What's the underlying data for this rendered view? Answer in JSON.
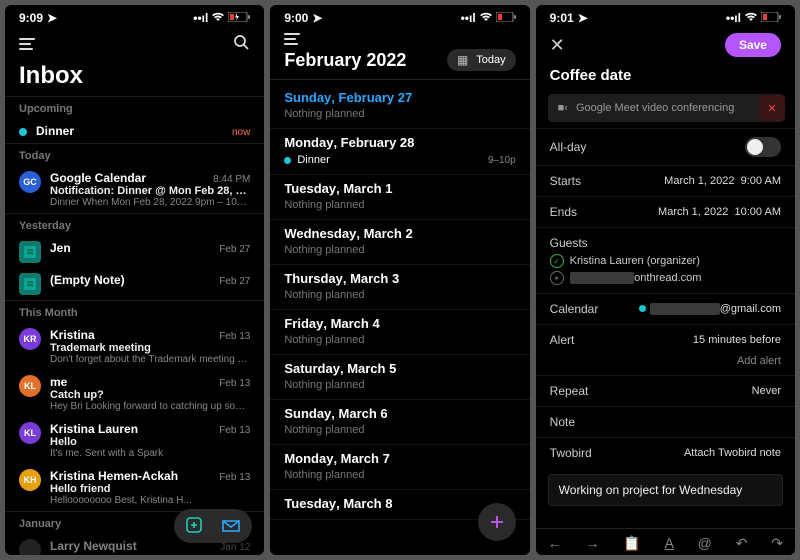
{
  "screen1": {
    "status_time": "9:09",
    "title": "Inbox",
    "sections": {
      "upcoming": "Upcoming",
      "today": "Today",
      "yesterday": "Yesterday",
      "this_month": "This Month",
      "january": "January"
    },
    "upcoming_item": {
      "label": "Dinner",
      "time": "now"
    },
    "today_item": {
      "sender": "Google Calendar",
      "time": "8:44 PM",
      "subject": "Notification: Dinner @ Mon Feb 28, 2022...",
      "preview": "Dinner When Mon Feb 28, 2022 9pm – 10pm P...",
      "avatar": "GC",
      "avatar_color": "#2a5fd8"
    },
    "yesterday_items": [
      {
        "sender": "Jen",
        "time": "Feb 27"
      },
      {
        "sender": "(Empty Note)",
        "time": "Feb 27"
      }
    ],
    "month_items": [
      {
        "avatar": "KR",
        "avatar_color": "#7a3bd8",
        "sender": "Kristina",
        "subject": "Trademark meeting",
        "preview": "Don't forget about the Trademark meeting on...",
        "time": "Feb 13"
      },
      {
        "avatar": "KL",
        "avatar_color": "#e2712a",
        "sender": "me",
        "subject": "Catch up?",
        "preview": "Hey Bri Looking forward to catching up soon! S...",
        "time": "Feb 13"
      },
      {
        "avatar": "KL",
        "avatar_color": "#7a3bd8",
        "sender": "Kristina Lauren",
        "subject": "Hello",
        "preview": "It's me. Sent with a Spark",
        "time": "Feb 13"
      },
      {
        "avatar": "KH",
        "avatar_color": "#e8a013",
        "sender": "Kristina Hemen-Ackah",
        "subject": "Hello friend",
        "preview": "Helloooooooo Best, Kristina H...",
        "time": "Feb 13"
      }
    ],
    "jan_item": {
      "sender": "Larry Newquist",
      "time": "Jan 12"
    }
  },
  "screen2": {
    "status_time": "9:00",
    "month_title": "February 2022",
    "today_label": "Today",
    "days": [
      {
        "dow": "Sunday",
        "rest": ", February 27",
        "today": true,
        "events": [],
        "nothing": "Nothing planned"
      },
      {
        "dow": "Monday",
        "rest": ", February 28",
        "events": [
          {
            "name": "Dinner",
            "time": "9–10p"
          }
        ]
      },
      {
        "dow": "Tuesday",
        "rest": ", March 1",
        "events": [],
        "nothing": "Nothing planned"
      },
      {
        "dow": "Wednesday",
        "rest": ", March 2",
        "events": [],
        "nothing": "Nothing planned"
      },
      {
        "dow": "Thursday",
        "rest": ", March 3",
        "events": [],
        "nothing": "Nothing planned"
      },
      {
        "dow": "Friday",
        "rest": ", March 4",
        "events": [],
        "nothing": "Nothing planned"
      },
      {
        "dow": "Saturday",
        "rest": ", March 5",
        "events": [],
        "nothing": "Nothing planned"
      },
      {
        "dow": "Sunday",
        "rest": ", March 6",
        "events": [],
        "nothing": "Nothing planned"
      },
      {
        "dow": "Monday",
        "rest": ", March 7",
        "events": [],
        "nothing": "Nothing planned"
      },
      {
        "dow": "Tuesday",
        "rest": ", March 8",
        "events": []
      }
    ]
  },
  "screen3": {
    "status_time": "9:01",
    "save": "Save",
    "title": "Coffee date",
    "meet_label": "Google Meet video conferencing",
    "allday": "All-day",
    "starts_label": "Starts",
    "starts_date": "March 1, 2022",
    "starts_time": "9:00 AM",
    "ends_label": "Ends",
    "ends_date": "March 1, 2022",
    "ends_time": "10:00 AM",
    "guests_label": "Guests",
    "guest1": "Kristina Lauren (organizer)",
    "guest2_suffix": "onthread.com",
    "calendar_label": "Calendar",
    "calendar_suffix": "@gmail.com",
    "alert_label": "Alert",
    "alert_value": "15 minutes before",
    "add_alert": "Add alert",
    "repeat_label": "Repeat",
    "repeat_value": "Never",
    "note_label": "Note",
    "twobird_label": "Twobird",
    "attach_link": "Attach Twobird note",
    "note_text": "Working on project for Wednesday"
  }
}
